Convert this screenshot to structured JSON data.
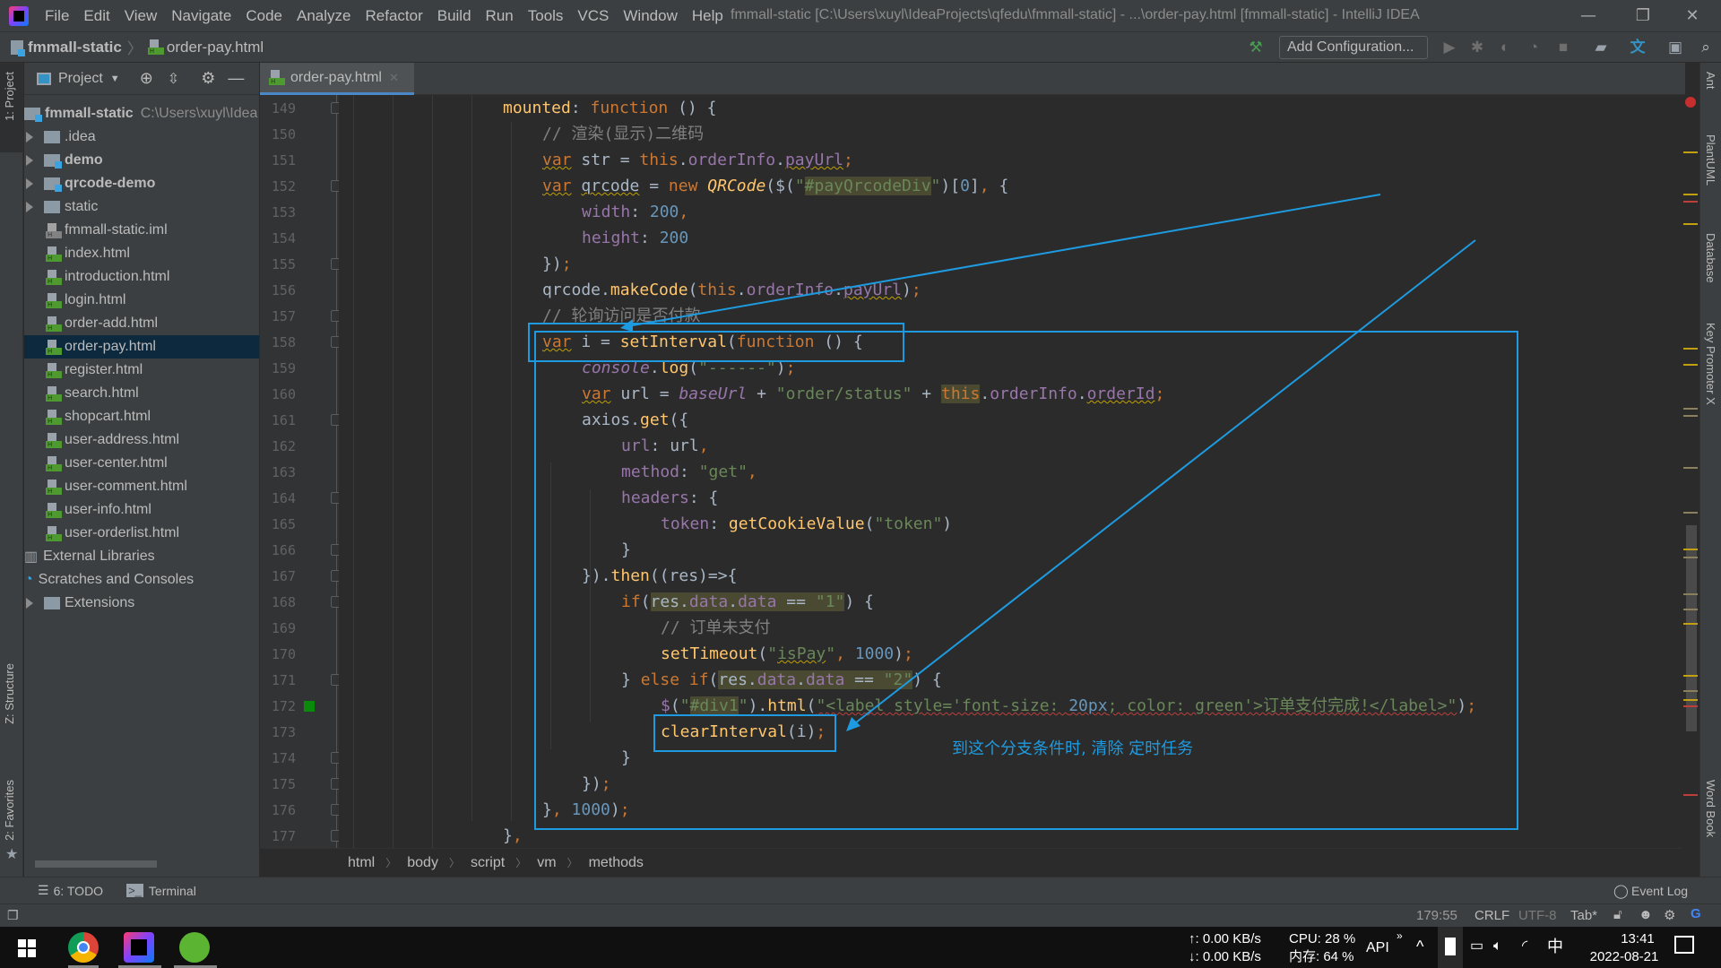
{
  "window": {
    "title": "fmmall-static [C:\\Users\\xuyl\\IdeaProjects\\qfedu\\fmmall-static] - ...\\order-pay.html [fmmall-static] - IntelliJ IDEA",
    "minimize": "—",
    "restore": "❐",
    "close": "✕"
  },
  "menu": [
    "File",
    "Edit",
    "View",
    "Navigate",
    "Code",
    "Analyze",
    "Refactor",
    "Build",
    "Run",
    "Tools",
    "VCS",
    "Window",
    "Help"
  ],
  "navbar": {
    "project": "fmmall-static",
    "file": "order-pay.html",
    "add_configuration": "Add Configuration..."
  },
  "left_strip": {
    "project": "1: Project",
    "structure": "Z: Structure",
    "favorites": "2: Favorites"
  },
  "right_strip": [
    "Ant",
    "PlantUML",
    "Database",
    "Key Promoter X",
    "Word Book"
  ],
  "project_panel": {
    "header": "Project",
    "root": {
      "name": "fmmall-static",
      "path": "C:\\Users\\xuyl\\Idea"
    },
    "items": [
      {
        "name": ".idea",
        "type": "folder",
        "bold": false
      },
      {
        "name": "demo",
        "type": "module",
        "bold": true
      },
      {
        "name": "qrcode-demo",
        "type": "module",
        "bold": true
      },
      {
        "name": "static",
        "type": "folder",
        "bold": false
      },
      {
        "name": "fmmall-static.iml",
        "type": "iml"
      },
      {
        "name": "index.html",
        "type": "html"
      },
      {
        "name": "introduction.html",
        "type": "html"
      },
      {
        "name": "login.html",
        "type": "html"
      },
      {
        "name": "order-add.html",
        "type": "html"
      },
      {
        "name": "order-pay.html",
        "type": "html",
        "selected": true
      },
      {
        "name": "register.html",
        "type": "html"
      },
      {
        "name": "search.html",
        "type": "html"
      },
      {
        "name": "shopcart.html",
        "type": "html"
      },
      {
        "name": "user-address.html",
        "type": "html"
      },
      {
        "name": "user-center.html",
        "type": "html"
      },
      {
        "name": "user-comment.html",
        "type": "html"
      },
      {
        "name": "user-info.html",
        "type": "html"
      },
      {
        "name": "user-orderlist.html",
        "type": "html"
      }
    ],
    "external_libraries": "External Libraries",
    "scratches": "Scratches and Consoles",
    "extensions": "Extensions"
  },
  "editor": {
    "tab": "order-pay.html",
    "line_numbers": [
      149,
      150,
      151,
      152,
      153,
      154,
      155,
      156,
      157,
      158,
      159,
      160,
      161,
      162,
      163,
      164,
      165,
      166,
      167,
      168,
      169,
      170,
      171,
      172,
      173,
      174,
      175,
      176,
      177
    ]
  },
  "annotation": {
    "text": "到这个分支条件时, 清除 定时任务",
    "color": "#1e9be0"
  },
  "breadcrumbs": [
    "html",
    "body",
    "script",
    "vm",
    "methods"
  ],
  "tool_windows": {
    "todo": "6: TODO",
    "terminal": "Terminal",
    "event_log": "Event Log"
  },
  "status": {
    "position": "179:55",
    "line_sep": "CRLF",
    "encoding": "UTF-8",
    "indent": "Tab*"
  },
  "taskbar": {
    "net_up": "↑: 0.00 KB/s",
    "net_down": "↓: 0.00 KB/s",
    "cpu": "CPU: 28 %",
    "mem": "内存: 64 %",
    "api": "API",
    "ime": "中",
    "time": "13:41",
    "date": "2022-08-21"
  }
}
